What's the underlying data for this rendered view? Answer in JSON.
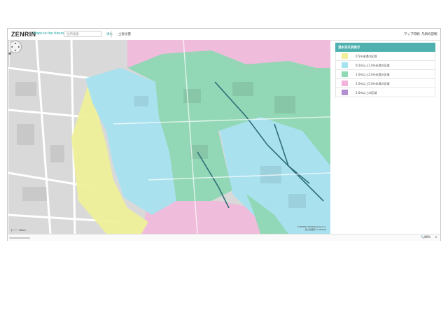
{
  "header": {
    "logo": "ZENRIN",
    "tagline": "Maps to the future",
    "search_placeholder": "住所検索",
    "tabs": [
      {
        "label": "洪水",
        "active": true
      },
      {
        "label": "土砂災害",
        "active": false
      }
    ],
    "links": [
      "マップ印刷",
      "凡例の説明"
    ]
  },
  "legend": {
    "title": "浸水深凡例表示",
    "items": [
      {
        "label": "0.5m未満の区域",
        "color": "#f2f09a"
      },
      {
        "label": "0.5m以上1.0m未満の区域",
        "color": "#a6e3f2"
      },
      {
        "label": "1.0m以上2.0m未満の区域",
        "color": "#8fd9b4"
      },
      {
        "label": "2.0m以上5.0m未満の区域",
        "color": "#f2b3d9"
      },
      {
        "label": "5.0m以上の区域",
        "color": "#b38fd1"
      }
    ]
  },
  "map": {
    "scale_label": "100m",
    "credit_line1": "©ZENRIN ZENRIN DataCom",
    "credit_line2": "国土地理院 ©ZENRIN"
  },
  "status": {
    "zoom": "80%"
  },
  "colors": {
    "accent": "#22a3a3",
    "legend_header": "#4fb0b0"
  }
}
